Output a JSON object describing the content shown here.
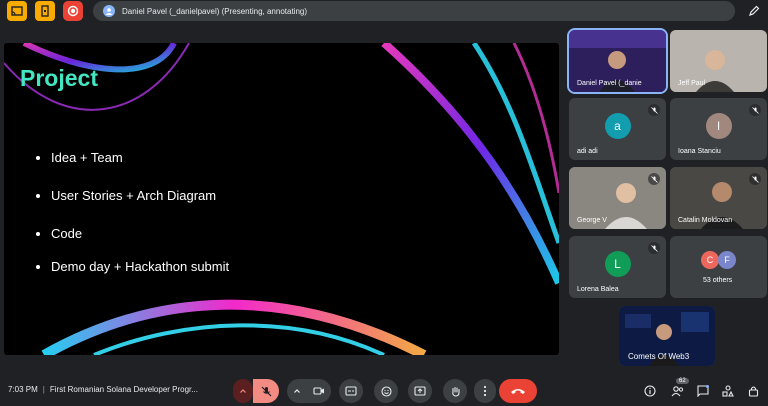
{
  "presenting_bar": {
    "text": "Daniel Pavel (_danielpavel) (Presenting, annotating)"
  },
  "slide": {
    "title": "Project",
    "bullets": [
      "Idea + Team",
      "User Stories + Arch Diagram",
      "Code",
      "Demo day + Hackathon submit"
    ]
  },
  "participants": [
    {
      "name": "Daniel Pavel (_danie",
      "type": "video"
    },
    {
      "name": "Jeff Paul",
      "type": "video"
    },
    {
      "name": "adi adi",
      "initial": "a",
      "color": "#129eaf"
    },
    {
      "name": "Ioana Stanciu",
      "initial": "I",
      "color": "#a1887f"
    },
    {
      "name": "George V",
      "type": "video"
    },
    {
      "name": "Catalin Moldovan",
      "type": "video"
    },
    {
      "name": "Lorena Balea",
      "initial": "L",
      "color": "#0f9d58"
    },
    {
      "name": "53 others",
      "initials": [
        "C",
        "F"
      ],
      "colors": [
        "#ee675c",
        "#7986cb"
      ]
    }
  ],
  "self_view": {
    "name": "Comets Of Web3"
  },
  "bottom": {
    "time": "7:03 PM",
    "separator": "|",
    "meeting_title": "First Romanian Solana Developer Progr...",
    "people_count": "62"
  },
  "colors": {
    "accent": "#8ab4f8",
    "end_call": "#ea4335",
    "slide_title": "#43e6c3"
  }
}
